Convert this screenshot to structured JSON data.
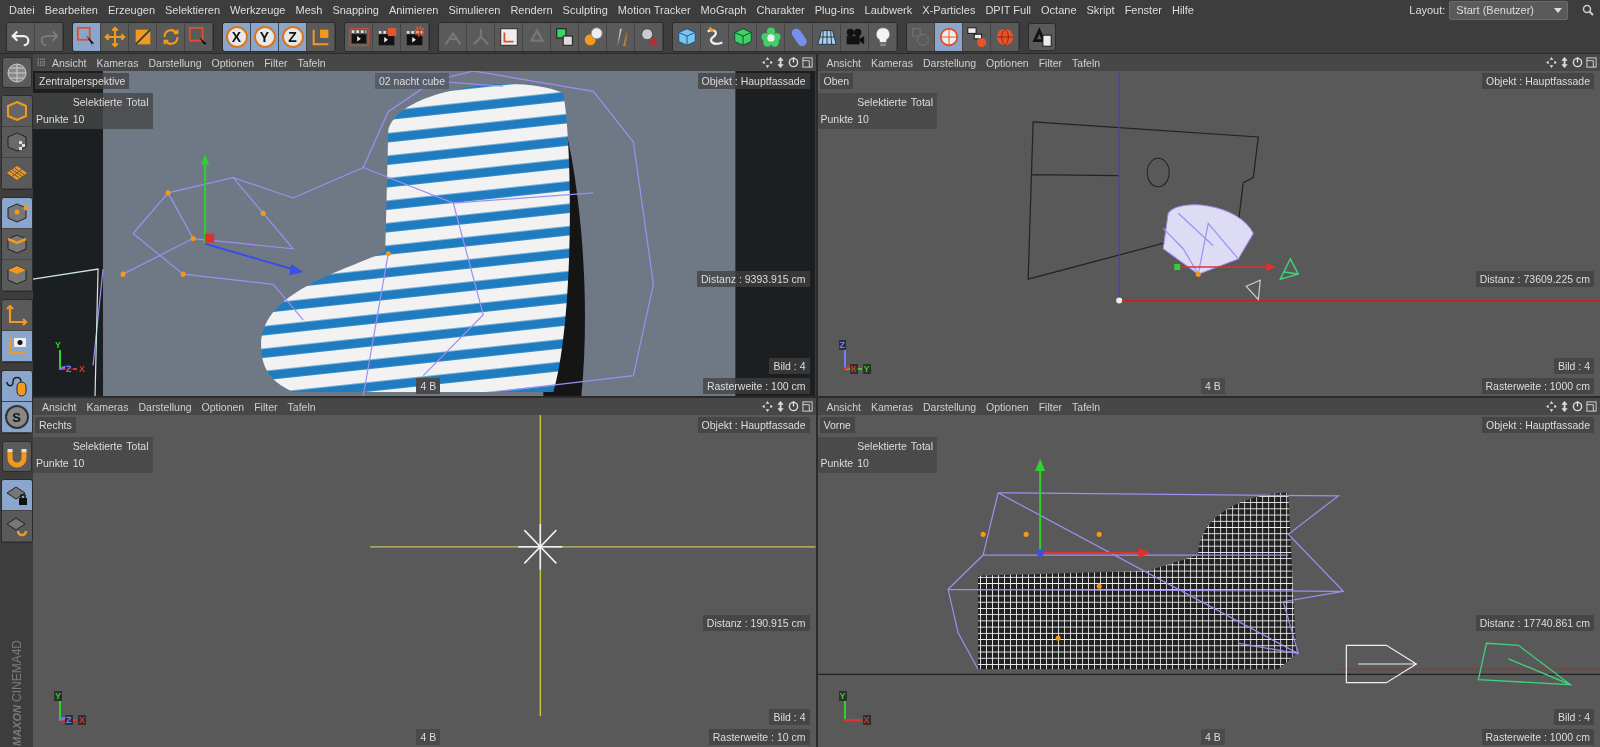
{
  "menu": [
    "Datei",
    "Bearbeiten",
    "Erzeugen",
    "Selektieren",
    "Werkzeuge",
    "Mesh",
    "Snapping",
    "Animieren",
    "Simulieren",
    "Rendern",
    "Sculpting",
    "Motion Tracker",
    "MoGraph",
    "Charakter",
    "Plug-ins",
    "Laubwerk",
    "X-Particles",
    "DPIT Full",
    "Octane",
    "Skript",
    "Fenster",
    "Hilfe"
  ],
  "layout": {
    "label": "Layout:",
    "value": "Start (Benutzer)"
  },
  "toolbar": [
    [
      {
        "kind": "undo",
        "selected": false,
        "disabled": false
      },
      {
        "kind": "redo",
        "selected": false,
        "disabled": true
      }
    ],
    [
      {
        "kind": "select",
        "selected": true,
        "disabled": false
      },
      {
        "kind": "move",
        "selected": false,
        "disabled": false
      },
      {
        "kind": "scale",
        "selected": false,
        "disabled": false
      },
      {
        "kind": "rotate",
        "selected": false,
        "disabled": false
      },
      {
        "kind": "rect-select",
        "selected": false,
        "disabled": false
      }
    ],
    [
      {
        "kind": "axis",
        "label": "X",
        "selected": true,
        "disabled": false
      },
      {
        "kind": "axis",
        "label": "Y",
        "selected": true,
        "disabled": false
      },
      {
        "kind": "axis",
        "label": "Z",
        "selected": true,
        "disabled": false
      },
      {
        "kind": "coords",
        "selected": false,
        "disabled": false
      }
    ],
    [
      {
        "kind": "clapper",
        "selected": false,
        "disabled": false
      },
      {
        "kind": "clapper-doc",
        "selected": false,
        "disabled": false
      },
      {
        "kind": "clapper-gear",
        "selected": false,
        "disabled": false
      }
    ],
    [
      {
        "kind": "bones",
        "selected": false,
        "disabled": true
      },
      {
        "kind": "joint",
        "selected": false,
        "disabled": true
      },
      {
        "kind": "frame",
        "selected": false,
        "disabled": false
      },
      {
        "kind": "recycle",
        "selected": false,
        "disabled": true
      },
      {
        "kind": "cubes",
        "selected": false,
        "disabled": false
      },
      {
        "kind": "spheres",
        "selected": false,
        "disabled": false
      },
      {
        "kind": "knife",
        "selected": false,
        "disabled": false
      },
      {
        "kind": "cone",
        "selected": false,
        "disabled": false
      }
    ],
    [
      {
        "kind": "cube",
        "selected": false,
        "disabled": false
      },
      {
        "kind": "spline",
        "selected": false,
        "disabled": false
      },
      {
        "kind": "cube-green",
        "selected": false,
        "disabled": false
      },
      {
        "kind": "flower",
        "selected": false,
        "disabled": false
      },
      {
        "kind": "capsule",
        "selected": false,
        "disabled": false
      },
      {
        "kind": "floor",
        "selected": false,
        "disabled": false
      },
      {
        "kind": "camera",
        "selected": false,
        "disabled": false
      },
      {
        "kind": "bulb",
        "selected": false,
        "disabled": false
      }
    ],
    [
      {
        "kind": "shape",
        "selected": false,
        "disabled": true
      },
      {
        "kind": "sphere-grid",
        "selected": true,
        "disabled": false
      },
      {
        "kind": "hierarchy",
        "selected": false,
        "disabled": false
      },
      {
        "kind": "sphere",
        "selected": false,
        "disabled": false
      }
    ],
    [
      {
        "kind": "recycle-doc",
        "selected": false,
        "disabled": false
      }
    ]
  ],
  "left_toolbar": [
    [
      {
        "kind": "model",
        "selected": false
      }
    ],
    [
      {
        "kind": "cube-orange",
        "selected": false
      },
      {
        "kind": "cube-tiles",
        "selected": false
      },
      {
        "kind": "grid-orange",
        "selected": false
      }
    ],
    [
      {
        "kind": "cube-points",
        "selected": true
      },
      {
        "kind": "cube-edges",
        "selected": false
      },
      {
        "kind": "cube-polys",
        "selected": false
      }
    ],
    [
      {
        "kind": "axis-l",
        "selected": false
      },
      {
        "kind": "axis-eye",
        "selected": true
      }
    ],
    [
      {
        "kind": "mouse",
        "selected": true
      },
      {
        "kind": "letter",
        "label": "S",
        "selected": true
      }
    ],
    [
      {
        "kind": "magnet",
        "selected": false
      }
    ],
    [
      {
        "kind": "grid-lock",
        "selected": true
      },
      {
        "kind": "grid-cycle",
        "selected": false
      }
    ]
  ],
  "logo": {
    "brand": "MAXON",
    "product": "CINEMA4D"
  },
  "viewports": [
    {
      "kind": "perspective",
      "menu": [
        "Ansicht",
        "Kameras",
        "Darstellung",
        "Optionen",
        "Filter",
        "Tafeln"
      ],
      "name": "Zentralperspektive",
      "camera": "02 nacht cube",
      "object": "Objekt : Hauptfassade",
      "stats": {
        "headings": [
          "Selektierte",
          "Total"
        ],
        "label": "Punkte",
        "value": "10"
      },
      "distance": "Distanz : 9393.915 cm",
      "frame": "Bild : 4",
      "memory": "4 B",
      "grid": "Rasterweite : 100 cm",
      "axes": [
        {
          "label": "Y",
          "color": "#2fd02f"
        },
        {
          "label": "X",
          "color": "#e03030"
        },
        {
          "label": "Z",
          "color": "#6f80ff"
        }
      ]
    },
    {
      "kind": "top",
      "menu": [
        "Ansicht",
        "Kameras",
        "Darstellung",
        "Optionen",
        "Filter",
        "Tafeln"
      ],
      "name": "Oben",
      "object": "Objekt : Hauptfassade",
      "stats": {
        "headings": [
          "Selektierte",
          "Total"
        ],
        "label": "Punkte",
        "value": "10"
      },
      "distance": "Distanz : 73609.225 cm",
      "frame": "Bild : 4",
      "memory": "4 B",
      "grid": "Rasterweite : 1000 cm",
      "axes": [
        {
          "label": "Z",
          "color": "#6f80ff"
        },
        {
          "label": "Y",
          "color": "#2fd02f"
        },
        {
          "label": "X",
          "color": "#e03030"
        }
      ]
    },
    {
      "kind": "side",
      "menu": [
        "Ansicht",
        "Kameras",
        "Darstellung",
        "Optionen",
        "Filter",
        "Tafeln"
      ],
      "name": "Rechts",
      "object": "Objekt : Hauptfassade",
      "stats": {
        "headings": [
          "Selektierte",
          "Total"
        ],
        "label": "Punkte",
        "value": "10"
      },
      "distance": "Distanz : 190.915 cm",
      "frame": "Bild : 4",
      "memory": "4 B",
      "grid": "Rasterweite : 10 cm",
      "axes": [
        {
          "label": "Y",
          "color": "#2fd02f"
        },
        {
          "label": "X",
          "color": "#e03030"
        },
        {
          "label": "Z",
          "color": "#6f80ff"
        }
      ]
    },
    {
      "kind": "front",
      "menu": [
        "Ansicht",
        "Kameras",
        "Darstellung",
        "Optionen",
        "Filter",
        "Tafeln"
      ],
      "name": "Vorne",
      "object": "Objekt : Hauptfassade",
      "stats": {
        "headings": [
          "Selektierte",
          "Total"
        ],
        "label": "Punkte",
        "value": "10"
      },
      "distance": "Distanz : 17740.861 cm",
      "frame": "Bild : 4",
      "memory": "4 B",
      "grid": "Rasterweite : 1000 cm",
      "axes": [
        {
          "label": "Y",
          "color": "#2fd02f"
        },
        {
          "label": "X",
          "color": "#e03030"
        }
      ]
    }
  ]
}
